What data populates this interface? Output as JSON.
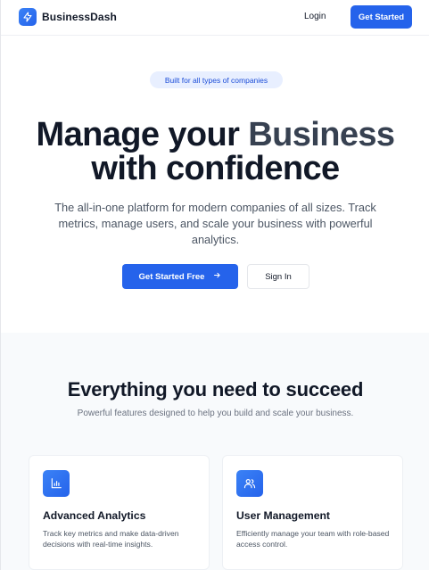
{
  "header": {
    "brand_name": "BusinessDash",
    "brand_icon": "lightning-icon",
    "login_label": "Login",
    "cta_label": "Get Started"
  },
  "hero": {
    "badge": "Built for all types of companies",
    "title_line1_a": "Manage your ",
    "title_line1_b": "Business",
    "title_line2": "with confidence",
    "subtitle": "The all-in-one platform for modern companies of all sizes. Track metrics, manage users, and scale your business with powerful analytics.",
    "primary_button": "Get Started Free",
    "primary_button_icon": "arrow-right-icon",
    "secondary_button": "Sign In"
  },
  "features": {
    "title": "Everything you need to succeed",
    "subtitle": "Powerful features designed to help you build and scale your business.",
    "cards": [
      {
        "icon": "bar-chart-icon",
        "title": "Advanced Analytics",
        "text": "Track key metrics and make data-driven decisions with real-time insights."
      },
      {
        "icon": "users-icon",
        "title": "User Management",
        "text": "Efficiently manage your team with role-based access control."
      }
    ]
  },
  "colors": {
    "primary": "#2563eb",
    "badge_bg": "#e8efff",
    "section_bg": "#f8fafc"
  }
}
